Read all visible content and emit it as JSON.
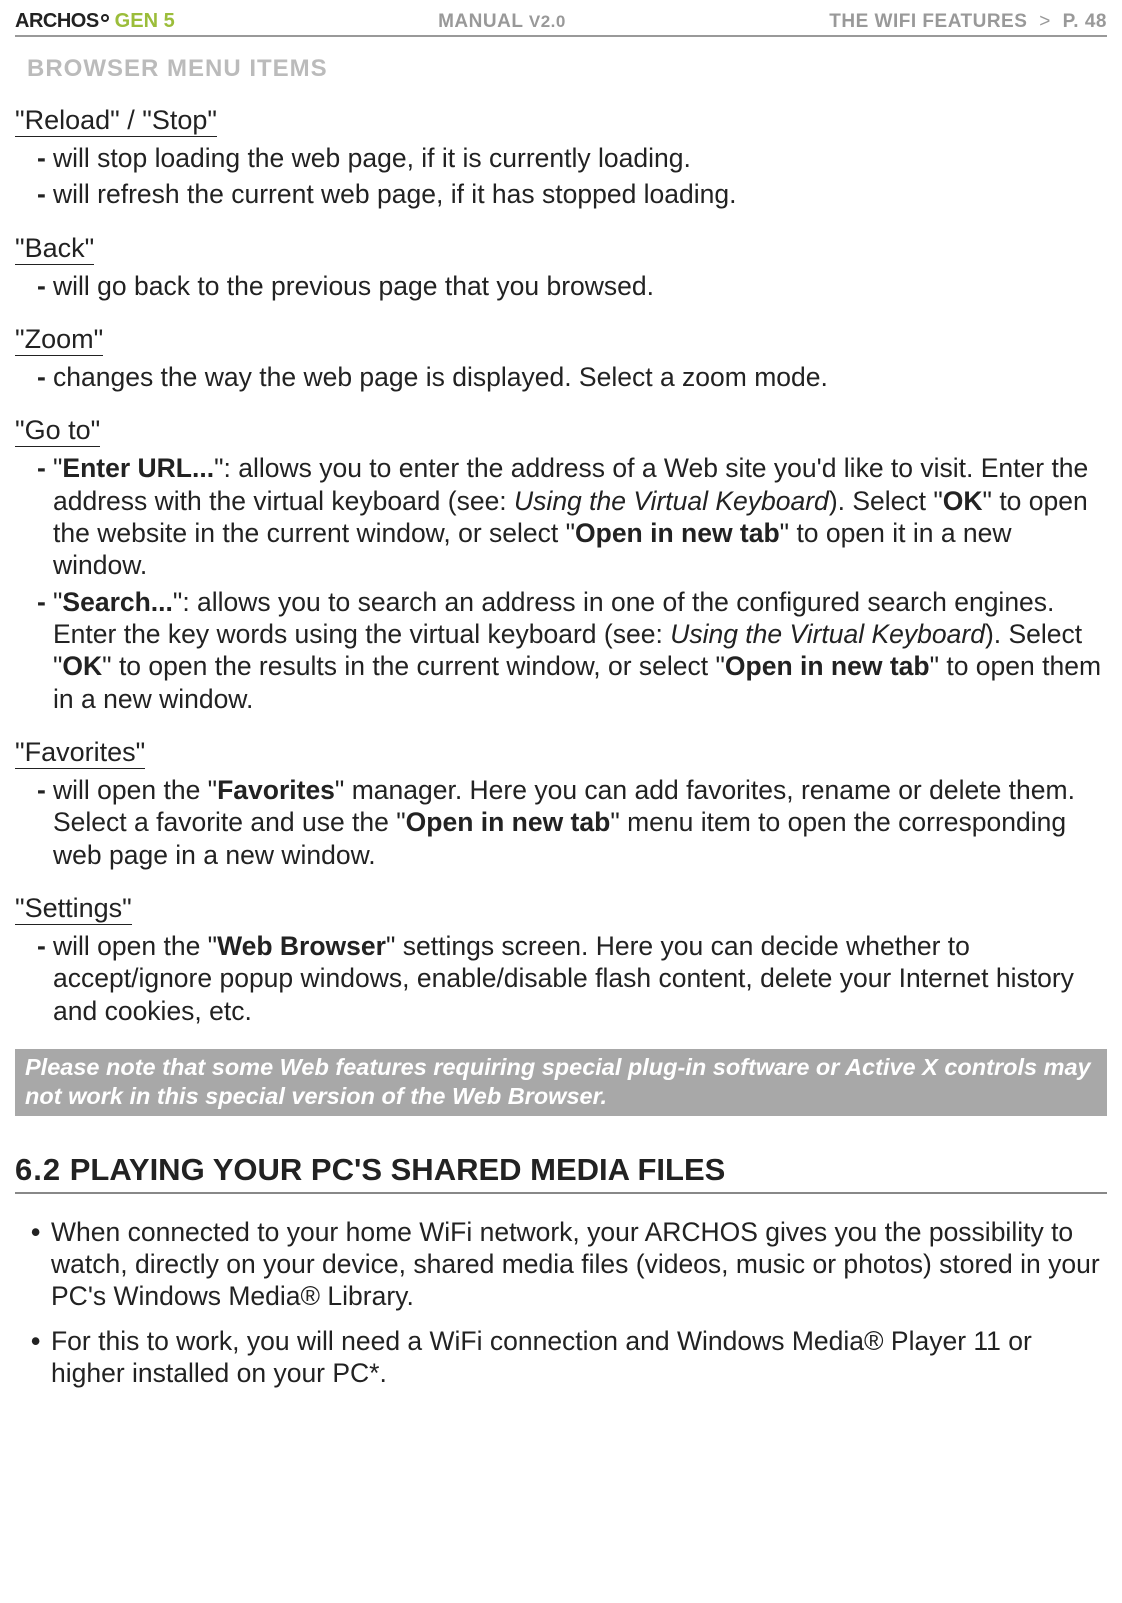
{
  "header": {
    "brand": "ARCHOS",
    "gen": "GEN 5",
    "manual": "MANUAL",
    "version": "V2.0",
    "section_name": "THE WIFI FEATURES",
    "page_label": "P. 48"
  },
  "subsection_title": "BROWSER MENU ITEMS",
  "menu_items": {
    "reload": {
      "title": "\"Reload\" / \"Stop\"",
      "points": [
        "will stop loading the web page, if it is currently loading.",
        "will refresh the current web page, if it has stopped loading."
      ]
    },
    "back": {
      "title": "\"Back\"",
      "points": [
        "will go back to the previous page that you browsed."
      ]
    },
    "zoom": {
      "title": "\"Zoom\"",
      "points": [
        "changes the way the web page is displayed. Select a zoom mode."
      ]
    },
    "goto": {
      "title": "\"Go to\"",
      "enter_url_label": "Enter URL...",
      "enter_url_text1": "\": allows you to enter the address of a Web site you'd like to visit. Enter the address with the virtual keyboard (see: ",
      "enter_url_ref": "Using the Virtual Keyboard",
      "enter_url_text2": "). Select \"",
      "ok": "OK",
      "enter_url_text3": "\" to open the website in the current window, or select \"",
      "open_new_tab": "Open in new tab",
      "enter_url_text4": "\" to open it in a new window.",
      "search_label": "Search...",
      "search_text1": "\": allows you to search an address in one of the configured search engines. Enter the key words using the virtual keyboard (see: ",
      "search_ref": "Using the Virtual Keyboard",
      "search_text2": "). Select \"",
      "search_text3": "\" to open the results in the current window, or select \"",
      "search_text4": "\" to open them in a new window."
    },
    "favorites": {
      "title": "\"Favorites\"",
      "text1": "will open the \"",
      "fav_label": "Favorites",
      "text2": "\" manager. Here you can add favorites, rename or delete them. Select a favorite and use the \"",
      "text3": "\" menu item to open the corresponding web page in a new window."
    },
    "settings": {
      "title": "\"Settings\"",
      "text1": "will open the \"",
      "wb_label": "Web Browser",
      "text2": "\" settings screen. Here you can decide whether to accept/ignore popup windows, enable/disable flash content, delete your Internet history and cookies, etc."
    }
  },
  "note": "Please note that some Web features requiring special plug-in software or Active X controls may not work in this special version of the Web Browser.",
  "section62": {
    "title": "6.2 Playing your PC's shared Media Files",
    "bullets": [
      "When connected to your home WiFi network, your ARCHOS gives you the possibility to watch, directly on your device, shared media files (videos, music or photos) stored in your PC's Windows Media® Library.",
      "For this to work, you will need a WiFi connection and Windows Media® Player 11 or higher installed on your PC*."
    ]
  }
}
